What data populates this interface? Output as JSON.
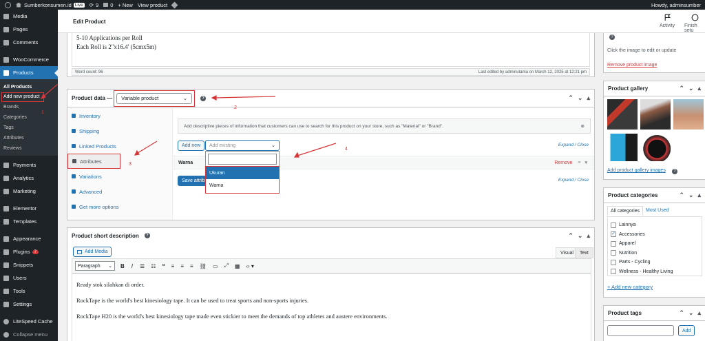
{
  "admin_bar": {
    "site_name": "Sumberkonsumen.id",
    "live_badge": "Live",
    "updates_count": "9",
    "comments_count": "0",
    "new_label": "+ New",
    "view_product": "View product",
    "howdy": "Howdy, adminsumber"
  },
  "sidebar": {
    "items_top": [
      {
        "label": "Media",
        "icon": "media-icon"
      },
      {
        "label": "Pages",
        "icon": "pages-icon"
      },
      {
        "label": "Comments",
        "icon": "comments-icon"
      }
    ],
    "woocommerce": "WooCommerce",
    "products": "Products",
    "submenu": [
      "All Products",
      "Add new product",
      "Brands",
      "Categories",
      "Tags",
      "Attributes",
      "Reviews"
    ],
    "submenu_annotation": "1",
    "items_bottom": [
      {
        "label": "Payments",
        "icon": "payments-icon"
      },
      {
        "label": "Analytics",
        "icon": "analytics-icon"
      },
      {
        "label": "Marketing",
        "icon": "marketing-icon"
      }
    ],
    "items_bottom2": [
      {
        "label": "Elementor",
        "icon": "elementor-icon"
      },
      {
        "label": "Templates",
        "icon": "templates-icon"
      }
    ],
    "items_bottom3": [
      {
        "label": "Appearance",
        "icon": "appearance-icon"
      },
      {
        "label": "Plugins",
        "icon": "plugins-icon",
        "badge": "7"
      },
      {
        "label": "Snippets",
        "icon": "snippets-icon"
      },
      {
        "label": "Users",
        "icon": "users-icon"
      },
      {
        "label": "Tools",
        "icon": "tools-icon"
      },
      {
        "label": "Settings",
        "icon": "settings-icon"
      }
    ],
    "litespeed": "LiteSpeed Cache",
    "collapse": "Collapse menu"
  },
  "header": {
    "title": "Edit Product",
    "activity": "Activity",
    "finish_setup": "Finish setu"
  },
  "description_box": {
    "line1": "5-10 Applications per Roll",
    "line2": "Each Roll is 2\"x16.4' (5cmx5m)",
    "word_count": "Word count: 96",
    "last_edited": "Last edited by adminutama on March 12, 2025 at 12:21 pm"
  },
  "product_data": {
    "label": "Product data —",
    "type_value": "Variable product",
    "annotation_2": "2",
    "annotation_3": "3",
    "annotation_4": "4",
    "tabs": [
      "Inventory",
      "Shipping",
      "Linked Products",
      "Attributes",
      "Variations",
      "Advanced",
      "Get more options"
    ],
    "info_text": "Add descriptive pieces of information that customers can use to search for this product on your store, such as \"Material\" or \"Brand\".",
    "add_new": "Add new",
    "add_existing_placeholder": "Add existing",
    "expand_close": "Expand / Close",
    "attribute_name": "Warna",
    "remove": "Remove",
    "save_attributes": "Save attributes",
    "dropdown_options": [
      "Ukuran",
      "Warna"
    ]
  },
  "short_description": {
    "title": "Product short description",
    "add_media": "Add Media",
    "tab_visual": "Visual",
    "tab_text": "Text",
    "format_select": "Paragraph",
    "paragraphs": [
      "Ready stok silahkan di order.",
      "RockTape is the world's best kinesiology tape. It can be used to treat sports and non-sports injuries.",
      "RockTape H20 is the world's best kinesiology tape made even stickier to meet the demands of top athletes and austere environments."
    ]
  },
  "product_image": {
    "click_text": "Click the image to edit or update",
    "remove_link": "Remove product image"
  },
  "product_gallery": {
    "title": "Product gallery",
    "add_link": "Add product gallery images"
  },
  "product_categories": {
    "title": "Product categories",
    "tab_all": "All categories",
    "tab_most_used": "Most Used",
    "items": [
      {
        "label": "Lainnya",
        "checked": false
      },
      {
        "label": "Accessories",
        "checked": true
      },
      {
        "label": "Apparel",
        "checked": false
      },
      {
        "label": "Nutrition",
        "checked": false
      },
      {
        "label": "Parts - Cycling",
        "checked": false
      },
      {
        "label": "Wellness - Healthy Living",
        "checked": false
      }
    ],
    "add_new": "+ Add new category"
  },
  "product_tags": {
    "title": "Product tags",
    "add_button": "Add"
  },
  "colors": {
    "accent": "#2271b1",
    "annotation_red": "#d63638",
    "sidebar_bg": "#1d2327"
  }
}
